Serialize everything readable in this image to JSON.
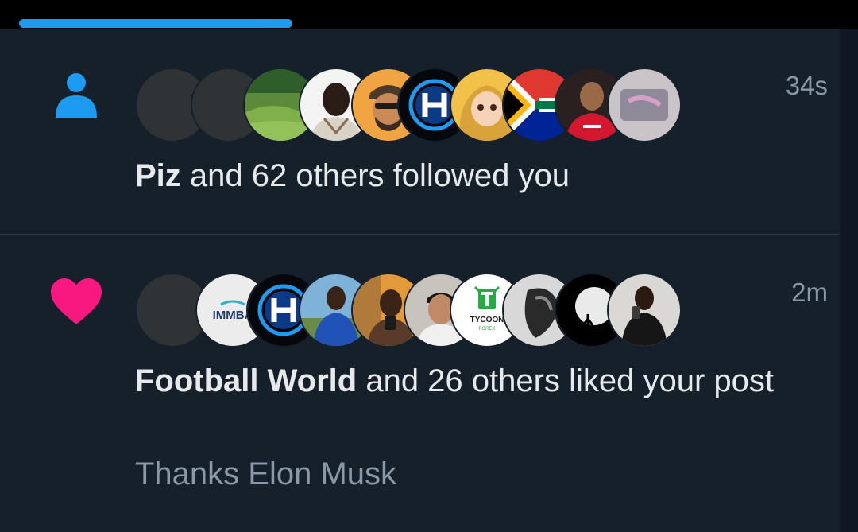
{
  "notifications": [
    {
      "type": "follow",
      "icon": "person-icon",
      "icon_color": "#1d9bf0",
      "timestamp": "34s",
      "actor": "Piz",
      "rest": " and 62 others followed you",
      "avatars": [
        "avatar-blank",
        "avatar-blank",
        "avatar-landscape",
        "avatar-man-white-shirt",
        "avatar-cartoon-cap",
        "avatar-h-logo",
        "avatar-cartoon-girl",
        "avatar-south-africa-flag",
        "avatar-red-jersey",
        "avatar-photo-blur"
      ]
    },
    {
      "type": "like",
      "icon": "heart-icon",
      "icon_color": "#f91880",
      "timestamp": "2m",
      "actor": "Football World",
      "rest": " and 26 others liked your post",
      "preview": "Thanks Elon Musk",
      "avatars": [
        "avatar-blank",
        "avatar-immba-logo",
        "avatar-h-logo",
        "avatar-blue-jersey",
        "avatar-selfie",
        "avatar-man-smiling",
        "avatar-tycoon-logo",
        "avatar-bw-photo",
        "avatar-moon",
        "avatar-mirror-selfie"
      ],
      "avatar_text": {
        "immba": "IMMBA",
        "tycoon": "TYCOON",
        "tycoon_sub": "FOREX"
      }
    }
  ],
  "colors": {
    "background": "#15202b",
    "text_primary": "#e7e9ea",
    "text_secondary": "#8b98a5",
    "progress": "#1d9bf0"
  }
}
